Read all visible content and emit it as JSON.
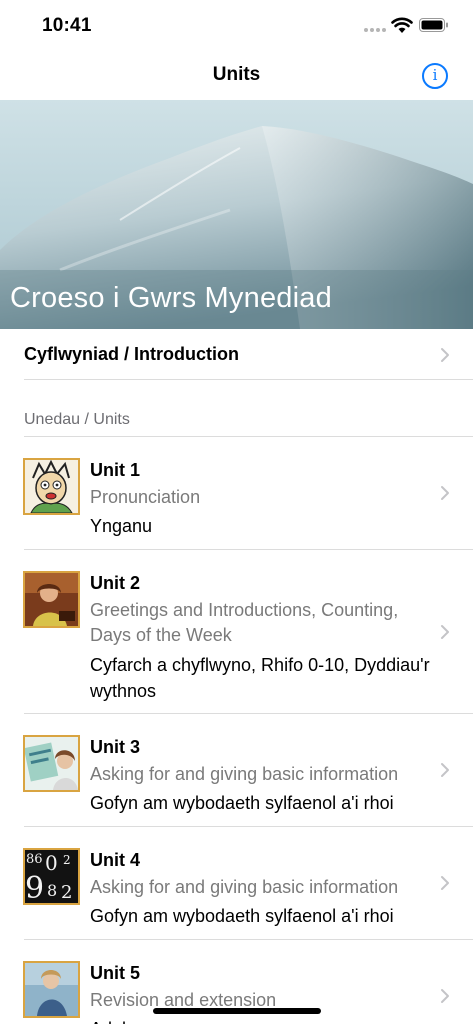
{
  "status_bar": {
    "time": "10:41"
  },
  "nav": {
    "title": "Units",
    "info_icon": "info-icon"
  },
  "hero": {
    "title": "Croeso i Gwrs Mynediad"
  },
  "intro": {
    "label": "Cyflwyniad / Introduction"
  },
  "section": {
    "header": "Unedau / Units"
  },
  "units": [
    {
      "title": "Unit 1",
      "english": "Pronunciation",
      "welsh": "Ynganu"
    },
    {
      "title": "Unit 2",
      "english": "Greetings and Introductions, Counting, Days of the Week",
      "welsh": "Cyfarch a chyflwyno, Rhifo 0-10, Dyddiau'r wythnos"
    },
    {
      "title": "Unit 3",
      "english": "Asking for and giving basic information",
      "welsh": "Gofyn am wybodaeth sylfaenol a'i rhoi"
    },
    {
      "title": "Unit 4",
      "english": "Asking for and giving basic information",
      "welsh": "Gofyn am wybodaeth sylfaenol a'i rhoi"
    },
    {
      "title": "Unit 5",
      "english": "Revision and extension",
      "welsh": "Adolygu"
    }
  ],
  "colors": {
    "accent": "#0a7aff",
    "thumb_border": "#d9a441",
    "secondary_text": "#7a7a7a"
  }
}
